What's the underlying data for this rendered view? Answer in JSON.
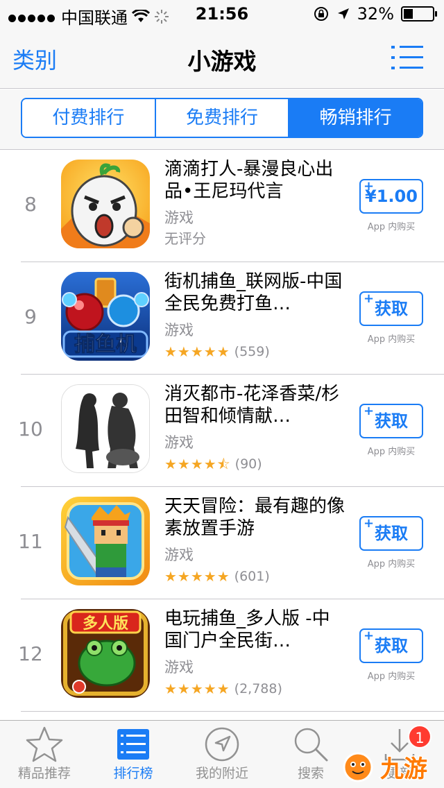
{
  "status_bar": {
    "carrier": "中国联通",
    "time": "21:56",
    "battery": "32%",
    "battery_level": 0.32
  },
  "nav": {
    "back_label": "类别",
    "title": "小游戏",
    "list_icon": "list-icon"
  },
  "segments": [
    {
      "label": "付费排行",
      "active": false
    },
    {
      "label": "免费排行",
      "active": false
    },
    {
      "label": "畅销排行",
      "active": true
    }
  ],
  "apps": [
    {
      "rank": "8",
      "name": "滴滴打人-暴漫良心出品•王尼玛代言",
      "category": "游戏",
      "rating_text": "无评分",
      "stars": 0,
      "count": "",
      "action": "¥1.00",
      "iap": "App 内购买"
    },
    {
      "rank": "9",
      "name": "街机捕鱼_联网版-中国全民免费打鱼…",
      "category": "游戏",
      "stars": 5,
      "count": "(559)",
      "action": "获取",
      "iap": "App 内购买"
    },
    {
      "rank": "10",
      "name": "消灭都市-花泽香菜/杉田智和倾情献…",
      "category": "游戏",
      "stars": 4.5,
      "count": "(90)",
      "action": "获取",
      "iap": "App 内购买"
    },
    {
      "rank": "11",
      "name": "天天冒险：最有趣的像素放置手游",
      "category": "游戏",
      "stars": 5,
      "count": "(601)",
      "action": "获取",
      "iap": "App 内购买"
    },
    {
      "rank": "12",
      "name": "电玩捕鱼_多人版 -中国门户全民街…",
      "category": "游戏",
      "stars": 5,
      "count": "(2,788)",
      "action": "获取",
      "iap": "App 内购买"
    }
  ],
  "icon_texts": {
    "icon_9": "捕鱼机",
    "icon_12": "多人版"
  },
  "tabs": [
    {
      "label": "精品推荐",
      "icon": "star-icon",
      "active": false
    },
    {
      "label": "排行榜",
      "icon": "ranking-list-icon",
      "active": true
    },
    {
      "label": "我的附近",
      "icon": "location-icon",
      "active": false
    },
    {
      "label": "搜索",
      "icon": "search-icon",
      "active": false
    },
    {
      "label": "更新",
      "icon": "update-icon",
      "active": false,
      "badge": "1"
    }
  ],
  "watermark": "九游",
  "colors": {
    "accent": "#1a7cf5",
    "star": "#f5a623",
    "badge": "#ff3b30",
    "secondary_text": "#8e8e93"
  }
}
